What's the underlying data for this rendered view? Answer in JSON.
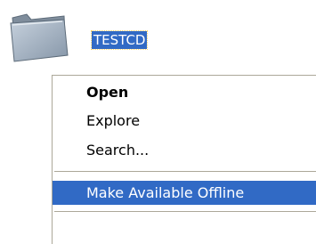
{
  "desktop": {
    "folder_icon": "folder-icon",
    "folder_label": "TESTCD"
  },
  "context_menu": {
    "items": [
      {
        "label": "Open",
        "bold": true
      },
      {
        "label": "Explore"
      },
      {
        "label": "Search..."
      },
      {
        "label": "Make Available Offline",
        "highlighted": true
      }
    ]
  },
  "colors": {
    "highlight": "#316ac5",
    "highlight_text": "#ffffff",
    "separator": "#aca899",
    "folder_fill": "#a7b4c1"
  }
}
